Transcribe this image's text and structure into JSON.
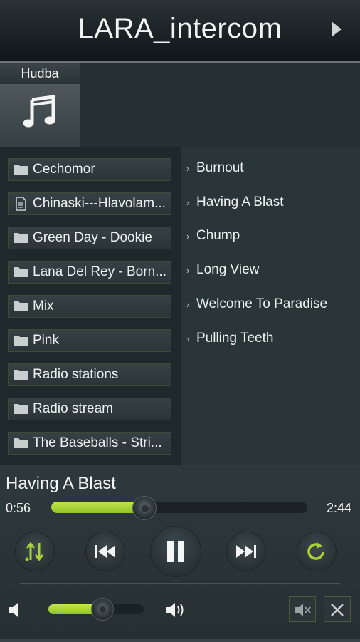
{
  "header": {
    "title": "LARA_intercom",
    "nav_icon": "play-arrow-icon"
  },
  "category": {
    "label": "Hudba",
    "icon": "music-note-icon"
  },
  "folders": [
    {
      "label": "Cechomor",
      "icon": "folder-icon"
    },
    {
      "label": "Chinaski---Hlavolam...",
      "icon": "file-icon"
    },
    {
      "label": "Green Day - Dookie",
      "icon": "folder-icon"
    },
    {
      "label": "Lana Del Rey - Born...",
      "icon": "folder-icon"
    },
    {
      "label": "Mix",
      "icon": "folder-icon"
    },
    {
      "label": "Pink",
      "icon": "folder-icon"
    },
    {
      "label": "Radio stations",
      "icon": "folder-icon"
    },
    {
      "label": "Radio stream",
      "icon": "folder-icon"
    },
    {
      "label": "The Baseballs - Stri...",
      "icon": "folder-icon"
    }
  ],
  "tracks": [
    {
      "label": "Burnout"
    },
    {
      "label": "Having A Blast"
    },
    {
      "label": "Chump"
    },
    {
      "label": "Long View"
    },
    {
      "label": "Welcome To Paradise"
    },
    {
      "label": "Pulling Teeth"
    }
  ],
  "player": {
    "now_playing": "Having A Blast",
    "elapsed": "0:56",
    "total": "2:44",
    "progress": 0.36,
    "volume": 0.56,
    "accent_color": "#a8d334"
  },
  "controls": {
    "shuffle_icon": "sort-arrows-icon",
    "prev_icon": "skip-previous-icon",
    "play_pause_icon": "pause-icon",
    "next_icon": "skip-next-icon",
    "repeat_icon": "repeat-icon",
    "volume_low_icon": "volume-low-icon",
    "volume_high_icon": "volume-high-icon",
    "mute_icon": "mute-icon",
    "close_icon": "close-icon"
  }
}
